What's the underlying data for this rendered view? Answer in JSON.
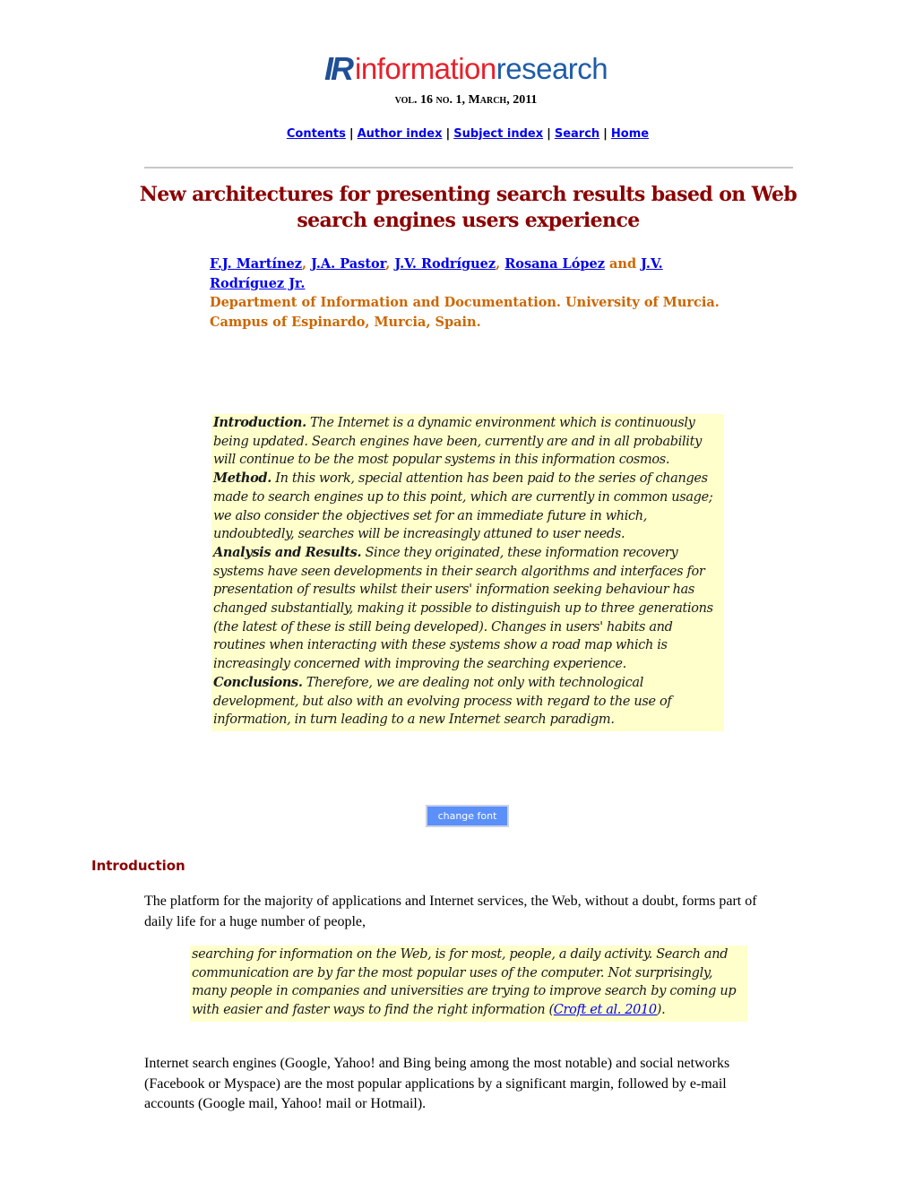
{
  "header": {
    "logo": {
      "ir": "IR",
      "info": "information",
      "research": "research"
    },
    "issue": "vol. 16 no. 1, March, 2011",
    "nav": [
      {
        "label": "Contents"
      },
      {
        "label": "Author index"
      },
      {
        "label": "Subject index"
      },
      {
        "label": "Search"
      },
      {
        "label": "Home"
      }
    ],
    "nav_separator": "|"
  },
  "article": {
    "title": "New architectures for presenting search results based on Web search engines users experience",
    "authors": [
      {
        "name": "F.J. Martínez",
        "after": ", "
      },
      {
        "name": "J.A. Pastor",
        "after": ", "
      },
      {
        "name": "J.V. Rodríguez",
        "after": ", "
      },
      {
        "name": "Rosana López",
        "after": " and "
      },
      {
        "name": "J.V. Rodríguez Jr.",
        "after": ""
      }
    ],
    "affiliation": "Department of Information and Documentation. University of Murcia. Campus of Espinardo, Murcia, Spain."
  },
  "abstract": [
    {
      "label": "Introduction.",
      "text": " The Internet is a dynamic environment which is continuously being updated. Search engines have been, currently are and in all probability will continue to be the most popular systems in this information cosmos."
    },
    {
      "label": "Method.",
      "text": " In this work, special attention has been paid to the series of changes made to search engines up to this point, which are currently in common usage; we also consider the objectives set for an immediate future in which, undoubtedly, searches will be increasingly attuned to user needs."
    },
    {
      "label": "Analysis and Results.",
      "text": " Since they originated, these information recovery systems have seen developments in their search algorithms and interfaces for presentation of results whilst their users' information seeking behaviour has changed substantially, making it possible to distinguish up to three generations (the latest of these is still being developed). Changes in users' habits and routines when interacting with these systems show a road map which is increasingly concerned with improving the searching experience."
    },
    {
      "label": "Conclusions.",
      "text": " Therefore, we are dealing not only with technological development, but also with an evolving process with regard to the use of information, in turn leading to a new Internet search paradigm."
    }
  ],
  "controls": {
    "change_font_label": "change font"
  },
  "body": {
    "section_heading": "Introduction",
    "para1": "The platform for the majority of applications and Internet services, the Web, without a doubt, forms part of daily life for a huge number of people,",
    "quote": {
      "text": "searching for information on the Web, is for most, people, a daily activity. Search and communication are by far the most popular uses of the computer. Not surprisingly, many people in companies and universities are trying to improve search by coming up with easier and faster ways to find the right information",
      "open": " (",
      "citation": "Croft et al. 2010",
      "close": ")."
    },
    "para2": "Internet search engines (Google, Yahoo! and Bing being among the most notable) and social networks (Facebook or Myspace) are the most popular applications by a significant margin, followed by e-mail accounts (Google mail, Yahoo! mail or Hotmail)."
  },
  "colors": {
    "title": "#8b0000",
    "affiliation": "#cc6600",
    "link": "#0000ee",
    "highlight_bg": "#ffffcc",
    "button_bg": "#5b8ff9",
    "logo_blue": "#1f4f96",
    "logo_red": "#e8202a"
  }
}
